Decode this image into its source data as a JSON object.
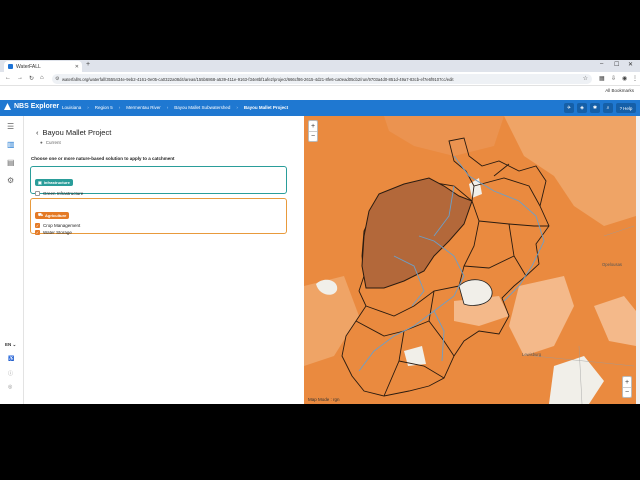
{
  "browser": {
    "tab_title": "WaterFALL",
    "url": "waterfallrs.org/waterfall/3555434e-9eb2-4161-0e05-ca0322a08d4/areas/155b6868-a539-411e-9163-f34e8bf1afe2/project/666cf86-2615-4d21-8fe6-ca0ead05cb2/run/9703a4d0-851d-49a7-83cb-ef7e6f9107cc/edit",
    "all_bookmarks": "All Bookmarks"
  },
  "app": {
    "logo": "NBS Explorer",
    "breadcrumb": [
      "Louisiana",
      "Region 5",
      "Mermentau River",
      "Bayou Mallet Subwatershed",
      "Bayou Mallet Project"
    ],
    "help": "Help"
  },
  "panel": {
    "project_title": "Bayou Mallet Project",
    "status": "Current",
    "instruction": "Choose one or more nature-based solution to apply to a catchment",
    "groups": [
      {
        "badge": "Infrastructure",
        "color": "#2a9d9a",
        "options": [
          {
            "label": "Green Infrastructure",
            "checked": false
          }
        ]
      },
      {
        "badge": "Agriculture",
        "color": "#e47a25",
        "options": [
          {
            "label": "Crop Management",
            "checked": true
          },
          {
            "label": "Water Storage",
            "checked": true
          }
        ]
      }
    ]
  },
  "rail": {
    "lang": "EN"
  },
  "map": {
    "mode_label": "Map Mode : rgn",
    "towns": [
      "Opelousas",
      "Lewisburg"
    ],
    "colors": {
      "base": "#ea8a3f",
      "light": "#f4b98a",
      "selected": "#b3683a",
      "river": "#6b9fc9",
      "white": "#f1efe9"
    }
  }
}
